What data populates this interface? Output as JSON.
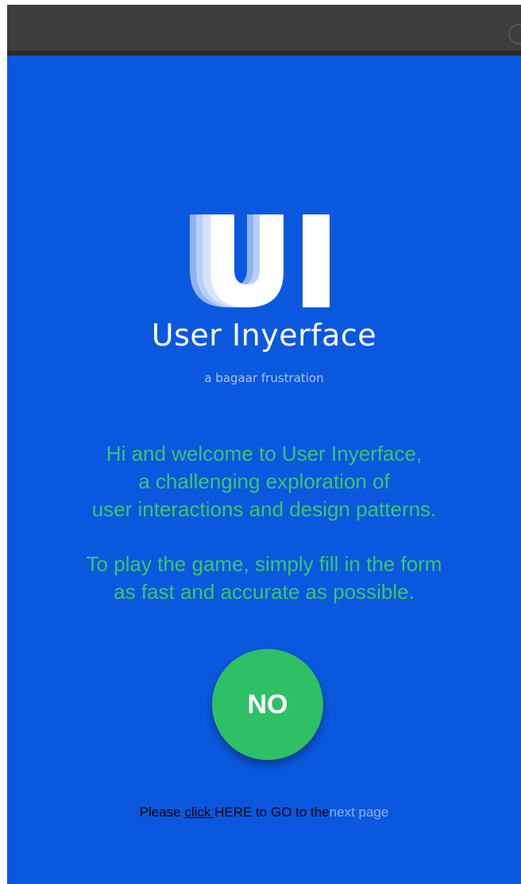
{
  "app": {
    "title": "User Inyerface",
    "tagline": "a bagaar frustration",
    "logo_letters": "UI",
    "colors": {
      "background": "#0b58de",
      "accent_green": "#3ec46d",
      "button_green": "#2fbf65",
      "topbar": "#3d3d3d"
    }
  },
  "welcome": {
    "lines": [
      "Hi and welcome to User Inyerface,",
      "a challenging exploration of",
      "user interactions and design patterns."
    ]
  },
  "instructions": {
    "lines": [
      "To play the game, simply fill in the form",
      "as fast and accurate as possible."
    ]
  },
  "start_button": {
    "label": "NO"
  },
  "footer": {
    "please": "Please",
    "click": "click",
    "middle": "HERE to GO to the",
    "next_page": "next page"
  },
  "icons": {
    "logo": "ui-logo-icon",
    "close": "close-circle-icon"
  }
}
